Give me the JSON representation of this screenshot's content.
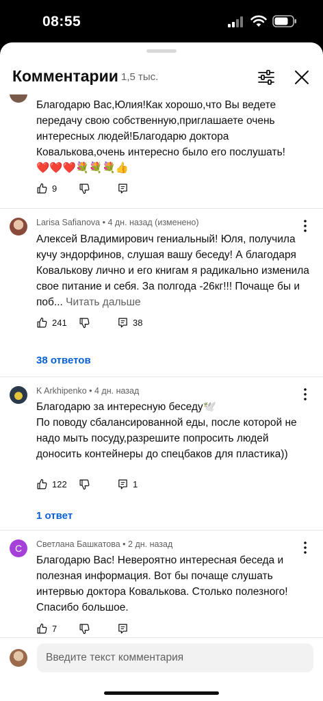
{
  "status": {
    "time": "08:55"
  },
  "header": {
    "title": "Комментарии",
    "count": "1,5 тыс."
  },
  "comments": [
    {
      "text": "Благодарю Вас,Юлия!Как хорошо,что Вы ведете передачу свою собственную,приглашаете очень интересных людей!Благодарю доктора Ковалькова,очень интересно было его послушать!",
      "emoji": "❤️❤️❤️💐💐💐👍",
      "likes": "9"
    },
    {
      "author": "Larisa Safianova",
      "time": "4 дн. назад (изменено)",
      "text": "Алексей Владимирович гениальный! Юля, получила кучу эндорфинов, слушая вашу беседу! А благодаря Ковалькову лично и его книгам я радикально изменила свое питание и себя. За полгода -26кг!!!  Почаще бы и поб...",
      "read_more": "Читать дальше",
      "likes": "241",
      "reply_count": "38",
      "replies_label": "38 ответов"
    },
    {
      "author": "K Arkhipenko",
      "time": "4 дн. назад",
      "text": "Благодарю за интересную беседу🕊️\nПо поводу сбалансированной еды, после которой не надо мыть посуду,разрешите попросить людей доносить контейнеры до спецбаков для пластика))",
      "likes": "122",
      "reply_count": "1",
      "replies_label": "1 ответ"
    },
    {
      "author": "Светлана Башкатова",
      "time": "2 дн. назад",
      "avatar_letter": "С",
      "text": "Благодарю Вас! Невероятно интересная беседа и полезная информация. Вот бы почаще слушать интервью доктора Ковалькова. Столько полезного! Спасибо большое.",
      "likes": "7"
    }
  ],
  "input": {
    "placeholder": "Введите текст комментария"
  },
  "colors": {
    "link": "#065fd4",
    "avatar_s": "#a540d8",
    "secondary_text": "#606060"
  }
}
